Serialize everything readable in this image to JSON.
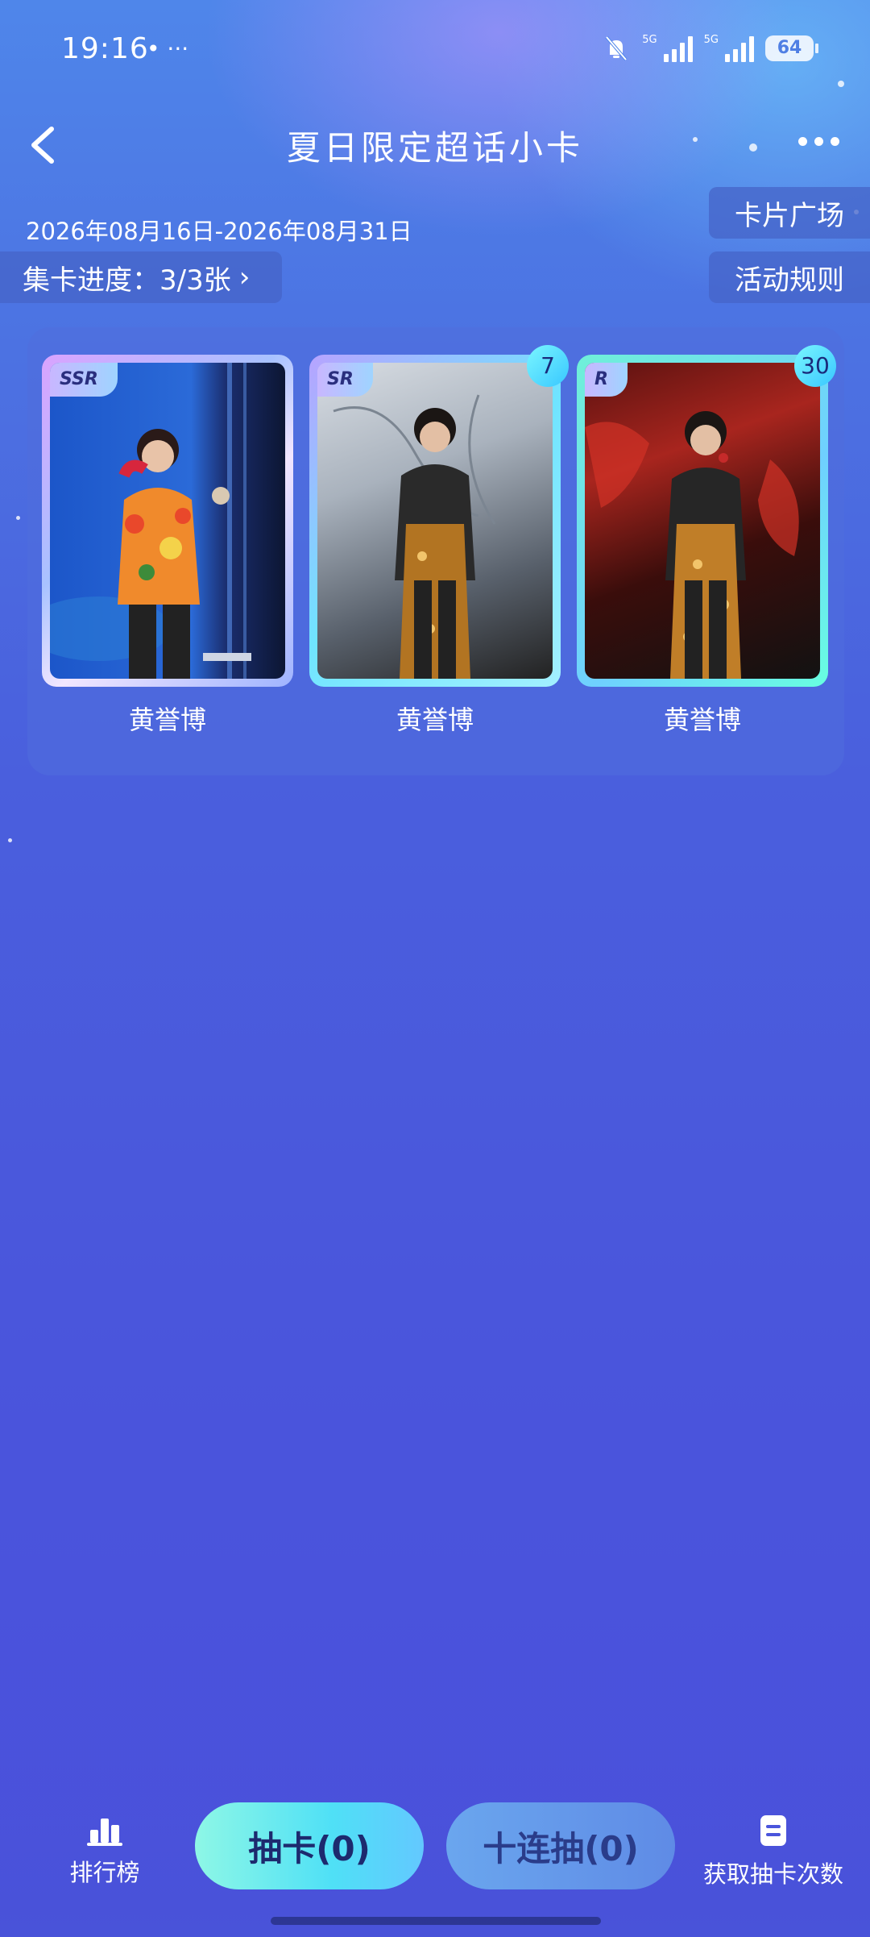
{
  "status_bar": {
    "time": "19:16",
    "left_icons": "• ···",
    "net1": "5G",
    "net2": "5G",
    "battery": "64"
  },
  "header": {
    "title": "夏日限定超话小卡"
  },
  "event": {
    "date_range": "2026年08月16日-2026年08月31日",
    "progress": "集卡进度：3/3张",
    "progress_chevron": "›",
    "square_button": "卡片广场",
    "rules_button": "活动规则"
  },
  "cards": [
    {
      "rarity": "SSR",
      "name": "黄誉博",
      "count": ""
    },
    {
      "rarity": "SR",
      "name": "黄誉博",
      "count": "7"
    },
    {
      "rarity": "R",
      "name": "黄誉博",
      "count": "30"
    }
  ],
  "bottom": {
    "rank_label": "排行榜",
    "draw_button": "抽卡(0)",
    "ten_draw_button": "十连抽(0)",
    "get_draws_label": "获取抽卡次数"
  },
  "colors": {
    "accent": "#4fe0f6",
    "background": "#4a55dc"
  },
  "icons": [
    "back-icon",
    "more-icon",
    "ranking-icon",
    "document-icon",
    "mute-icon",
    "signal-icon",
    "battery-icon"
  ]
}
